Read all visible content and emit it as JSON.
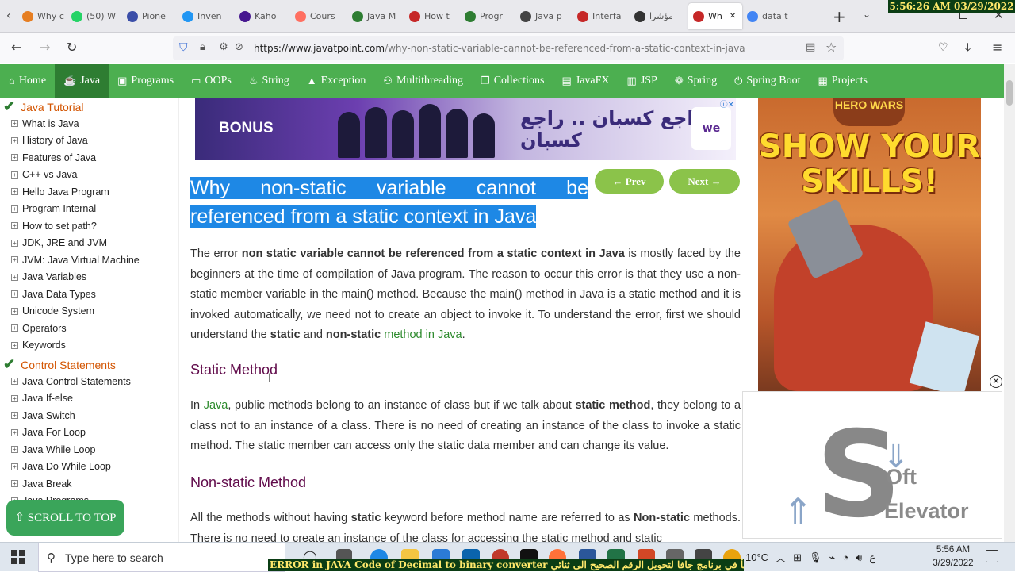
{
  "recording_clock": "5:56:26 AM 03/29/2022",
  "tabs": [
    {
      "label": "Why c",
      "color": "#e67e22"
    },
    {
      "label": "(50) W",
      "color": "#25d366"
    },
    {
      "label": "Pione",
      "color": "#3b4ea8"
    },
    {
      "label": "Inven",
      "color": "#2196f3"
    },
    {
      "label": "Kaho",
      "color": "#46178f"
    },
    {
      "label": "Cours",
      "color": "#ff6f61"
    },
    {
      "label": "Java M",
      "color": "#2e7d32"
    },
    {
      "label": "How t",
      "color": "#c62828"
    },
    {
      "label": "Progr",
      "color": "#2e7d32"
    },
    {
      "label": "Java p",
      "color": "#444"
    },
    {
      "label": "Interfa",
      "color": "#c62828"
    },
    {
      "label": "مؤشرا",
      "color": "#333"
    },
    {
      "label": "Wh",
      "color": "#c62828"
    },
    {
      "label": "data t",
      "color": "#4285f4"
    }
  ],
  "new_tab_label": "+",
  "address": {
    "domain": "https://www.javatpoint.com",
    "path": "/why-non-static-variable-cannot-be-referenced-from-a-static-context-in-java"
  },
  "menu": [
    {
      "label": "Home",
      "icon": "home-icon",
      "glyph": "⌂",
      "active": false
    },
    {
      "label": "Java",
      "icon": "coffee-icon",
      "glyph": "☕",
      "active": true
    },
    {
      "label": "Programs",
      "icon": "programs-icon",
      "glyph": "▣",
      "active": false
    },
    {
      "label": "OOPs",
      "icon": "oops-icon",
      "glyph": "▭",
      "active": false
    },
    {
      "label": "String",
      "icon": "string-icon",
      "glyph": "♨",
      "active": false
    },
    {
      "label": "Exception",
      "icon": "warning-icon",
      "glyph": "▲",
      "active": false
    },
    {
      "label": "Multithreading",
      "icon": "threads-icon",
      "glyph": "⚇",
      "active": false
    },
    {
      "label": "Collections",
      "icon": "collections-icon",
      "glyph": "❐",
      "active": false
    },
    {
      "label": "JavaFX",
      "icon": "javafx-icon",
      "glyph": "▤",
      "active": false
    },
    {
      "label": "JSP",
      "icon": "jsp-icon",
      "glyph": "▥",
      "active": false
    },
    {
      "label": "Spring",
      "icon": "spring-icon",
      "glyph": "❁",
      "active": false
    },
    {
      "label": "Spring Boot",
      "icon": "spring-boot-icon",
      "glyph": "⏻",
      "active": false
    },
    {
      "label": "Projects",
      "icon": "projects-icon",
      "glyph": "▦",
      "active": false
    }
  ],
  "sidebar": {
    "section1": "Java Tutorial",
    "items1": [
      "What is Java",
      "History of Java",
      "Features of Java",
      "C++ vs Java",
      "Hello Java Program",
      "Program Internal",
      "How to set path?",
      "JDK, JRE and JVM",
      "JVM: Java Virtual Machine",
      "Java Variables",
      "Java Data Types",
      "Unicode System",
      "Operators",
      "Keywords"
    ],
    "section2": "Control Statements",
    "items2": [
      "Java Control Statements",
      "Java If-else",
      "Java Switch",
      "Java For Loop",
      "Java While Loop",
      "Java Do While Loop",
      "Java Break",
      "Java Programs"
    ],
    "scroll_top": "⇧ SCROLL TO TOP"
  },
  "ad_top": {
    "bonus": "BONUS",
    "brand": "we",
    "arabic": "راجع كسبان .. راجع كسبان"
  },
  "article": {
    "title": "Why non-static variable cannot be referenced from a static context in Java",
    "prev": "← Prev",
    "next": "Next →",
    "p1": {
      "t1": "The error ",
      "b1": "non static variable cannot be referenced from a static context in Java",
      "t2": " is mostly faced by the beginners at the time of compilation of Java program. The reason to occur this error is that they use a non-static member variable in the main() method. Because the main() method in Java is a static method and it is invoked automatically, we need not to create an object to invoke it. To understand the error, first we should understand the ",
      "b2": "static",
      "t3": " and ",
      "b3": "non-static",
      "t4": " ",
      "link": "method in Java",
      "t5": "."
    },
    "h_static": "Static Method",
    "p2": {
      "t1": "In ",
      "link": "Java",
      "t2": ", public methods belong to an instance of class but if we talk about ",
      "b1": "static method",
      "t3": ", they belong to a class not to an instance of a class. There is no need of creating an instance of the class to invoke a static method. The static member can access only the static data member and can change its value."
    },
    "h_nonstatic": "Non-static Method",
    "p3": {
      "t1": "All the methods without having ",
      "b1": "static",
      "t2": " keyword before method name are referred to as ",
      "b2": "Non-static",
      "t3": " methods. There is no need to create an instance of the class for accessing the static method and static"
    }
  },
  "ad_right": {
    "logo": "HERO WARS",
    "slogan": "SHOW YOUR SKILLS!"
  },
  "video_overlay": {
    "letter": "S",
    "word1": "Oft",
    "word2": "Elevator"
  },
  "taskbar": {
    "search_placeholder": "Type here to search",
    "temperature": "10°C",
    "lang": "ع",
    "time": "5:56 AM",
    "date": "3/29/2022"
  },
  "ticker": "ERROR in JAVA Code of Decimal to binary converter  خطأ في برنامج جافا لتحويل الرقم الصحيح الى ثنائي"
}
